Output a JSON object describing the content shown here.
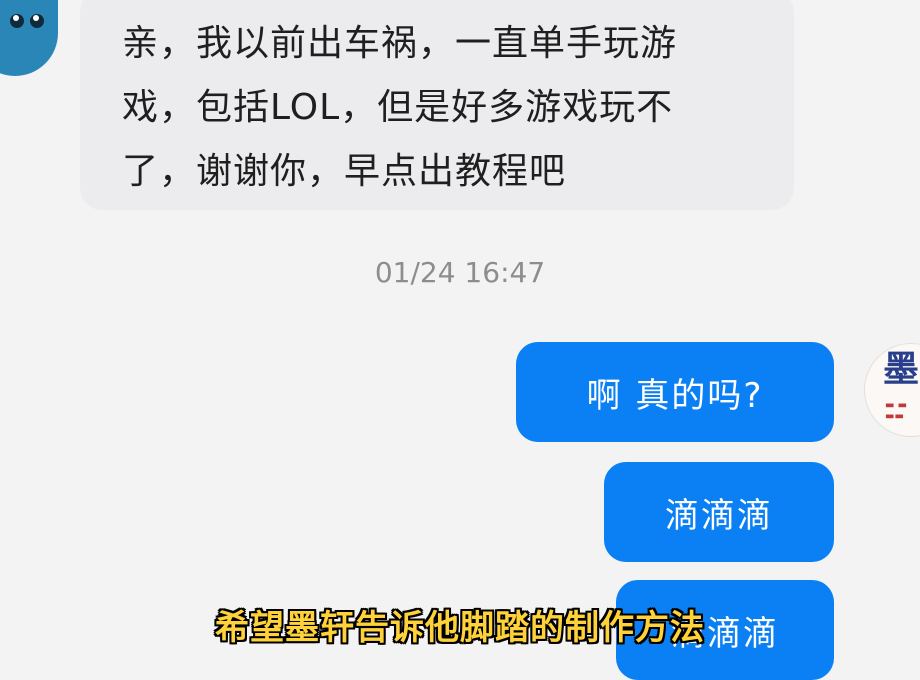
{
  "incoming_message": {
    "lines": [
      "亲，我以前出车祸，一直单手玩游",
      "戏，包括LOL，但是好多游戏玩不",
      "了，谢谢你，早点出教程吧"
    ]
  },
  "timestamp": "01/24 16:47",
  "outgoing_messages": [
    "啊  真的吗?",
    "滴滴滴",
    "滴滴滴"
  ],
  "avatar_right": {
    "glyph": "墨",
    "icon": "brand-logo-icon"
  },
  "avatar_left": {
    "icon": "cartoon-avatar-icon"
  },
  "caption": "希望墨轩告诉他脚踏的制作方法",
  "colors": {
    "background": "#f3f3f4",
    "incoming_bubble": "#ececee",
    "outgoing_bubble": "#0b80f4",
    "caption_text": "#ffd23a"
  }
}
